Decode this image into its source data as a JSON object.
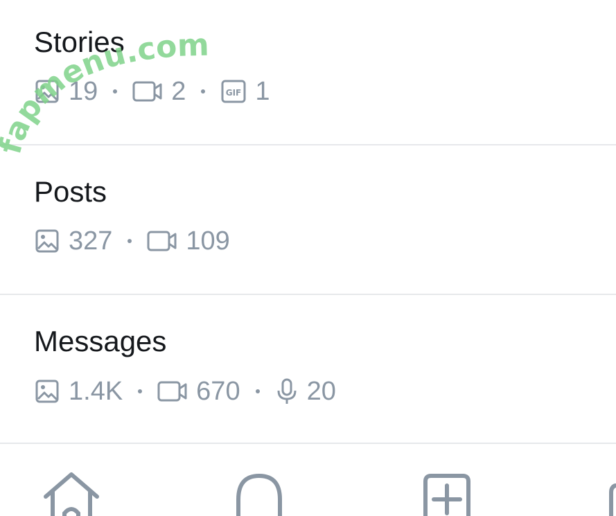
{
  "sections": [
    {
      "title": "Stories",
      "stats": [
        {
          "icon": "image-icon",
          "count": "19"
        },
        {
          "icon": "video-icon",
          "count": "2"
        },
        {
          "icon": "gif-icon",
          "count": "1"
        }
      ]
    },
    {
      "title": "Posts",
      "stats": [
        {
          "icon": "image-icon",
          "count": "327"
        },
        {
          "icon": "video-icon",
          "count": "109"
        }
      ]
    },
    {
      "title": "Messages",
      "stats": [
        {
          "icon": "image-icon",
          "count": "1.4K"
        },
        {
          "icon": "video-icon",
          "count": "670"
        },
        {
          "icon": "microphone-icon",
          "count": "20"
        }
      ]
    }
  ],
  "watermark": "fapmenu.com",
  "bottom_nav": [
    {
      "icon": "home-icon"
    },
    {
      "icon": "bell-icon"
    },
    {
      "icon": "add-post-icon"
    },
    {
      "icon": "more-icon"
    }
  ],
  "colors": {
    "title": "#15181c",
    "muted": "#8a96a3",
    "divider": "#e6e8eb",
    "watermark": "#7fd38a"
  }
}
